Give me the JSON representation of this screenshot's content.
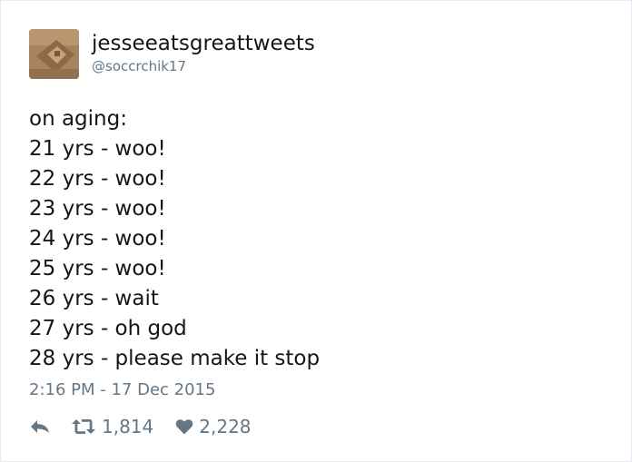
{
  "tweet": {
    "user": {
      "display_name": "jesseeatsgreattweets",
      "handle": "@soccrchik17"
    },
    "text_lines": [
      "on aging:",
      "21 yrs - woo!",
      "22 yrs - woo!",
      "23 yrs - woo!",
      "24 yrs - woo!",
      "25 yrs - woo!",
      "26 yrs - wait",
      "27 yrs - oh god",
      "28 yrs - please make it stop"
    ],
    "timestamp": "2:16 PM - 17 Dec 2015",
    "actions": {
      "reply_icon": "reply-icon",
      "retweet_icon": "retweet-icon",
      "retweet_count": "1,814",
      "like_icon": "heart-icon",
      "like_count": "2,228"
    }
  },
  "colors": {
    "text": "#14171a",
    "muted": "#657786",
    "border": "#e6ecf0"
  }
}
